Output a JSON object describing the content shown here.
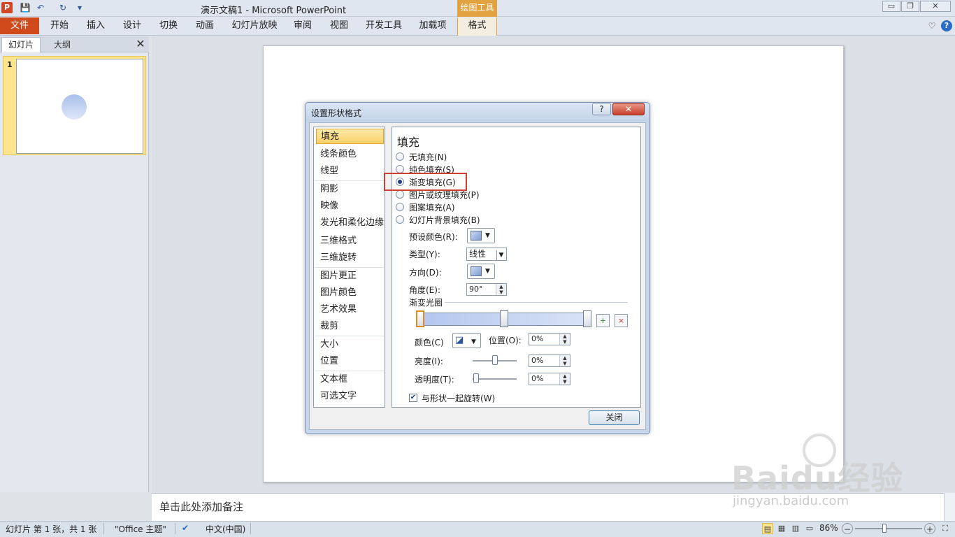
{
  "window": {
    "title": "演示文稿1  -  Microsoft PowerPoint",
    "tools_tab": "绘图工具",
    "app_icon": "P",
    "controls": {
      "minimize": "▭",
      "maximize": "❐",
      "close": "✕"
    }
  },
  "quick_access": {
    "save_icon": "💾",
    "undo_icon": "↶",
    "redo_icon": "↻",
    "customize_icon": "▾"
  },
  "ribbon": {
    "file_tab": "文件",
    "tabs": [
      "开始",
      "插入",
      "设计",
      "切换",
      "动画",
      "幻灯片放映",
      "审阅",
      "视图",
      "开发工具",
      "加载项"
    ],
    "format_tab": "格式",
    "minimize_icon": "♡",
    "help_icon": "?"
  },
  "left_pane": {
    "tab_slides": "幻灯片",
    "tab_outline": "大纲",
    "close_icon": "✕",
    "slide_number": "1"
  },
  "notes": {
    "placeholder": "单击此处添加备注"
  },
  "status": {
    "slide_info": "幻灯片 第 1 张，共 1 张",
    "theme": "\"Office 主题\"",
    "language": "中文(中国)",
    "zoom": "86%",
    "zoom_out": "−",
    "zoom_in": "+"
  },
  "dialog": {
    "title": "设置形状格式",
    "help": "?",
    "close": "✕",
    "categories": [
      "填充",
      "线条颜色",
      "线型",
      "阴影",
      "映像",
      "发光和柔化边缘",
      "三维格式",
      "三维旋转",
      "图片更正",
      "图片颜色",
      "艺术效果",
      "裁剪",
      "大小",
      "位置",
      "文本框",
      "可选文字"
    ],
    "selected_category": "填充",
    "panel_heading": "填充",
    "fill_options": [
      "无填充(N)",
      "纯色填充(S)",
      "渐变填充(G)",
      "图片或纹理填充(P)",
      "图案填充(A)",
      "幻灯片背景填充(B)"
    ],
    "selected_fill": "渐变填充(G)",
    "preset_label": "预设颜色(R):",
    "type_label": "类型(Y):",
    "type_value": "线性",
    "direction_label": "方向(D):",
    "angle_label": "角度(E):",
    "angle_value": "90°",
    "stops_label": "渐变光圈",
    "color_label": "颜色(C)",
    "position_label": "位置(O):",
    "position_value": "0%",
    "brightness_label": "亮度(I):",
    "brightness_value": "0%",
    "transparency_label": "透明度(T):",
    "transparency_value": "0%",
    "rotate_label": "与形状一起旋转(W)",
    "rotate_checked": true,
    "close_button": "关闭",
    "gradient_colors": [
      "#b3c6ee",
      "#d9e3f6"
    ]
  },
  "watermark": {
    "logo": "Baidu经验",
    "url": "jingyan.baidu.com"
  },
  "colors": {
    "file_tab": "#d04a1b",
    "tools_tab": "#e2a23f",
    "highlight": "#d43b33",
    "selection": "#fde58d"
  }
}
